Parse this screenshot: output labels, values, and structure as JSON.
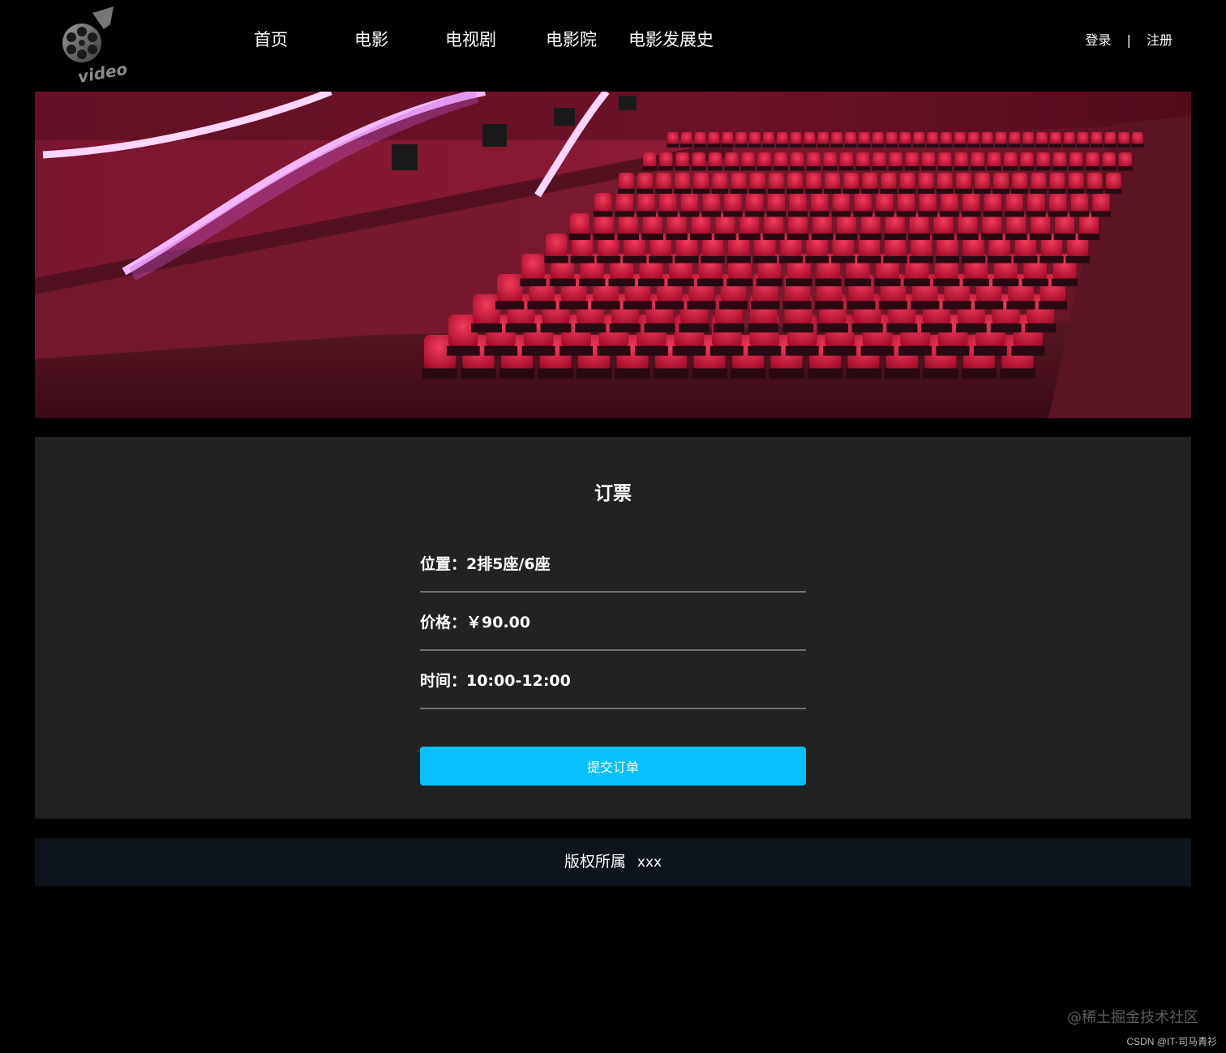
{
  "header": {
    "logo_text": "video",
    "nav": [
      "首页",
      "电影",
      "电视剧",
      "电影院",
      "电影发展史"
    ],
    "login": "登录",
    "separator": "|",
    "register": "注册"
  },
  "order": {
    "title": "订票",
    "rows": [
      {
        "label": "位置：",
        "value": "2排5座/6座"
      },
      {
        "label": "价格：",
        "value": "￥90.00"
      },
      {
        "label": "时间：",
        "value": "10:00-12:00"
      }
    ],
    "submit_label": "提交订单"
  },
  "footer": {
    "copyright": "版权所属",
    "owner": "xxx"
  },
  "watermarks": {
    "juejin": "@稀土掘金技术社区",
    "csdn": "CSDN @IT-司马青衫"
  },
  "colors": {
    "accent": "#07c0fc",
    "panel": "#222222",
    "footer": "#0e141b"
  }
}
